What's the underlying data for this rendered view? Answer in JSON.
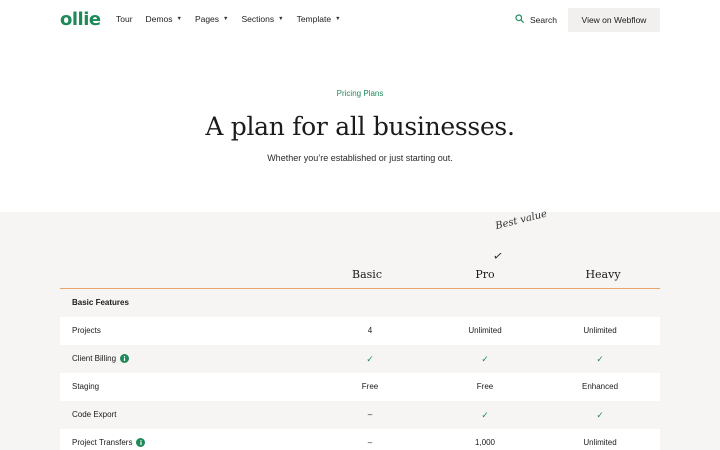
{
  "nav": {
    "logo": "ollie",
    "links": [
      {
        "label": "Tour",
        "caret": ""
      },
      {
        "label": "Demos",
        "caret": "▼"
      },
      {
        "label": "Pages",
        "caret": "▼"
      },
      {
        "label": "Sections",
        "caret": "▼"
      },
      {
        "label": "Template",
        "caret": "▼"
      }
    ],
    "search_label": "Search",
    "cta_label": "View on Webflow"
  },
  "hero": {
    "eyebrow": "Pricing Plans",
    "title": "A plan for all businesses.",
    "subtitle": "Whether you’re established or just starting out."
  },
  "pricing": {
    "best_value": "Best value",
    "arrow": "✓",
    "plans": [
      "Basic",
      "Pro",
      "Heavy"
    ],
    "section_label": "Basic Features",
    "info_glyph": "i",
    "rows": [
      {
        "feature": "Projects",
        "info": false,
        "values": [
          "4",
          "Unlimited",
          "Unlimited"
        ]
      },
      {
        "feature": "Client Billing",
        "info": true,
        "values": [
          "✓",
          "✓",
          "✓"
        ]
      },
      {
        "feature": "Staging",
        "info": false,
        "values": [
          "Free",
          "Free",
          "Enhanced"
        ]
      },
      {
        "feature": "Code Export",
        "info": false,
        "values": [
          "–",
          "✓",
          "✓"
        ]
      },
      {
        "feature": "Project Transfers",
        "info": true,
        "values": [
          "–",
          "1,000",
          "Unlimited"
        ]
      }
    ]
  },
  "colors": {
    "brand": "#1e8a5a",
    "divider": "#e8a46a",
    "section_bg": "#f6f5f3"
  }
}
